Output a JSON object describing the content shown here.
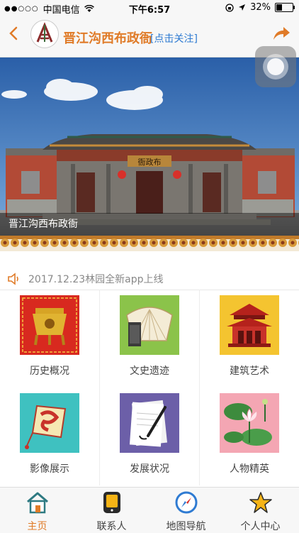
{
  "status_bar": {
    "signal": "●●○○○",
    "carrier": "中国电信",
    "time": "下午6:57",
    "battery": "32%",
    "battery_level": 0.32
  },
  "header": {
    "title": "晋江沟西布政衙",
    "follow": "[点击关注]",
    "accent": "#e07b28",
    "link_color": "#2f7bd2"
  },
  "banner": {
    "caption": "晋江沟西布政衙",
    "plaque": "衙政布"
  },
  "notice": {
    "text": "2017.12.23林园全新app上线"
  },
  "grid": [
    {
      "label": "历史概况",
      "icon": "bronze-vessel-icon"
    },
    {
      "label": "文史遗迹",
      "icon": "scroll-fan-icon"
    },
    {
      "label": "建筑艺术",
      "icon": "pavilion-icon"
    },
    {
      "label": "影像展示",
      "icon": "lantern-icon"
    },
    {
      "label": "发展状况",
      "icon": "paper-brush-icon"
    },
    {
      "label": "人物精英",
      "icon": "lotus-icon"
    }
  ],
  "tabbar": [
    {
      "label": "主页",
      "icon": "home-icon",
      "active": true
    },
    {
      "label": "联系人",
      "icon": "contacts-icon",
      "active": false
    },
    {
      "label": "地图导航",
      "icon": "compass-icon",
      "active": false
    },
    {
      "label": "个人中心",
      "icon": "star-icon",
      "active": false
    }
  ]
}
